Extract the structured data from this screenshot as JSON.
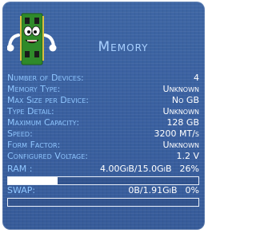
{
  "widget": {
    "title": "Memory",
    "icon": "memory-module-mascot-icon"
  },
  "details": [
    {
      "label": "Number of Devices:",
      "value": "4"
    },
    {
      "label": "Memory Type:",
      "value": "Unknown"
    },
    {
      "label": "Max Size per Device:",
      "value": "No GB"
    },
    {
      "label": "Type Detail:",
      "value": "Unknown"
    },
    {
      "label": "Maximum Capacity:",
      "value": "128 GB"
    },
    {
      "label": "Speed:",
      "value": "3200 MT/s"
    },
    {
      "label": "Form Factor:",
      "value": "Unknown"
    },
    {
      "label": "Configured Voltage:",
      "value": "1.2 V"
    }
  ],
  "ram": {
    "label": "RAM :",
    "amount": "4.00GiB/15.0GiB",
    "percent": "26%",
    "fraction": 0.26
  },
  "swap": {
    "label": "SWAP:",
    "amount": "0B/1.91GiB",
    "percent": "0%",
    "fraction": 0
  },
  "colors": {
    "background": "#3a60a0",
    "label": "#8fc6ff",
    "value": "#ffffff",
    "title": "#a8d0ff"
  }
}
